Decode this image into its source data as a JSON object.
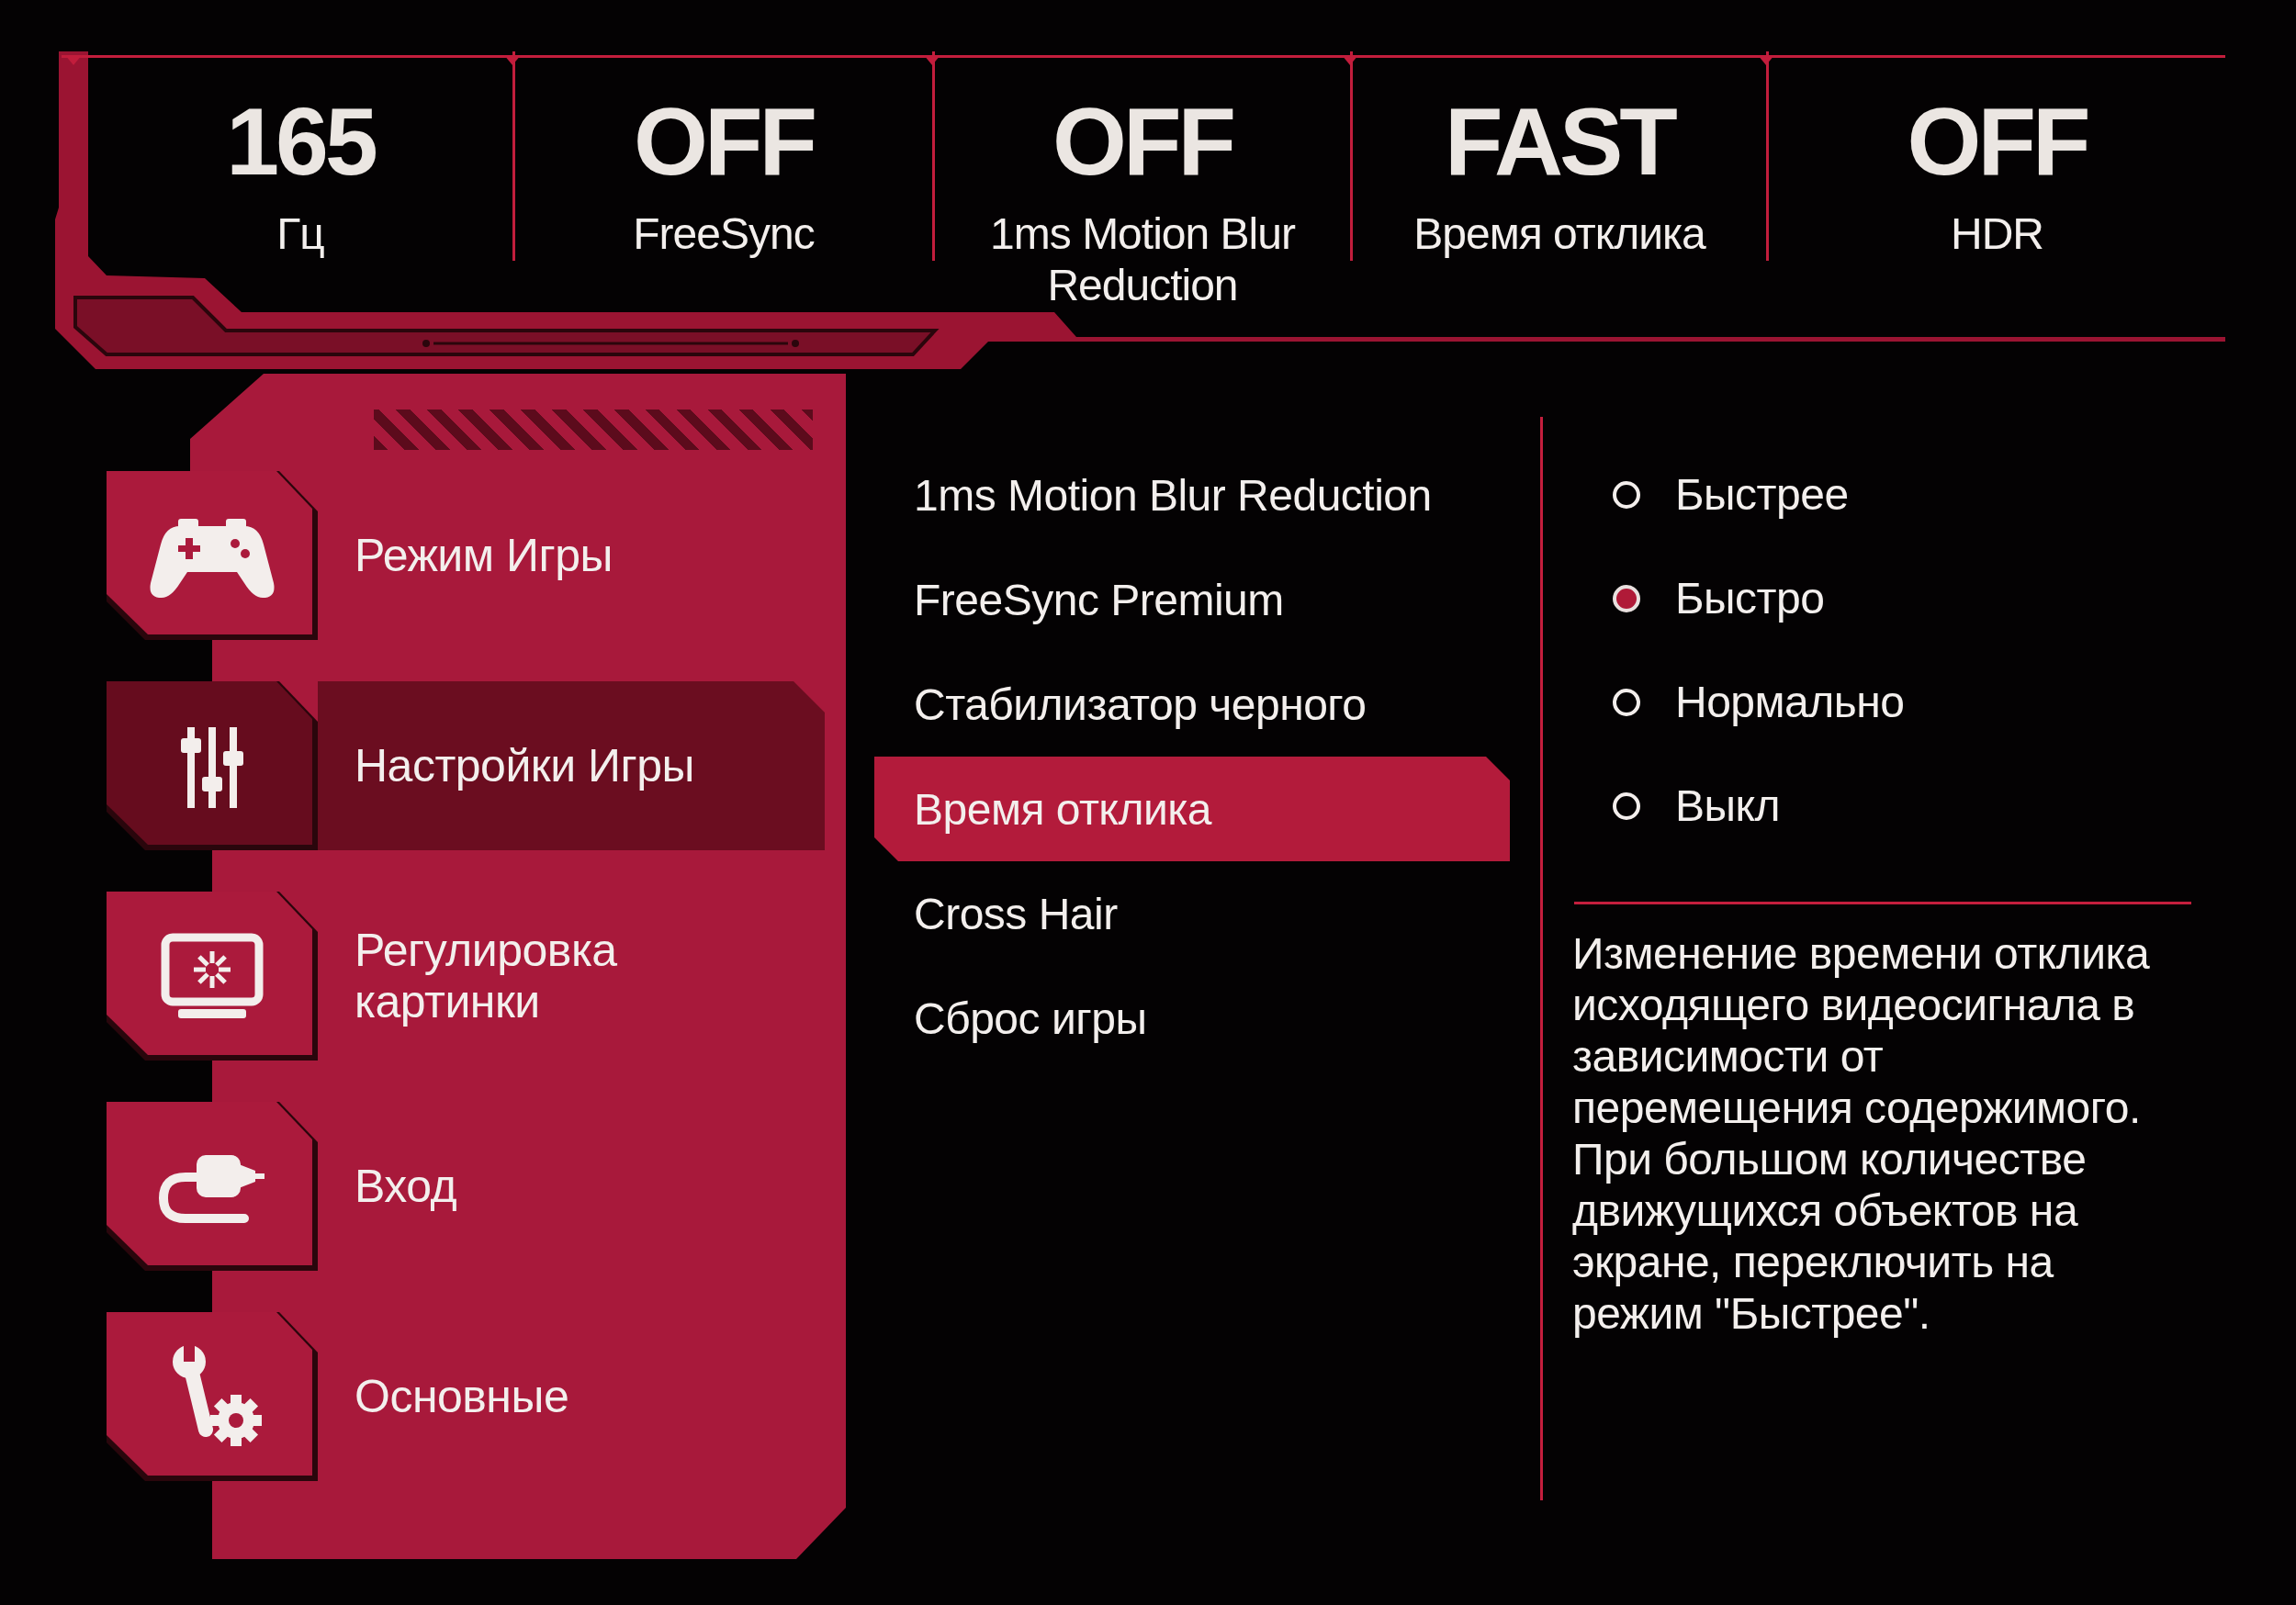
{
  "status_bar": [
    {
      "value": "165",
      "label": "Гц"
    },
    {
      "value": "OFF",
      "label": "FreeSync"
    },
    {
      "value": "OFF",
      "label": "1ms Motion Blur Reduction"
    },
    {
      "value": "FAST",
      "label": "Время отклика"
    },
    {
      "value": "OFF",
      "label": "HDR"
    }
  ],
  "sidebar": {
    "items": [
      {
        "label": "Режим Игры",
        "selected": false
      },
      {
        "label": "Настройки Игры",
        "selected": true
      },
      {
        "label": "Регулировка картинки",
        "selected": false
      },
      {
        "label": "Вход",
        "selected": false
      },
      {
        "label": "Основные",
        "selected": false
      }
    ]
  },
  "submenu": {
    "items": [
      {
        "label": "1ms Motion Blur Reduction",
        "selected": false
      },
      {
        "label": "FreeSync Premium",
        "selected": false
      },
      {
        "label": "Стабилизатор черного",
        "selected": false
      },
      {
        "label": "Время отклика",
        "selected": true
      },
      {
        "label": "Cross Hair",
        "selected": false
      },
      {
        "label": "Сброс игры",
        "selected": false
      }
    ]
  },
  "options": {
    "items": [
      {
        "label": "Быстрее",
        "selected": false
      },
      {
        "label": "Быстро",
        "selected": true
      },
      {
        "label": "Нормально",
        "selected": false
      },
      {
        "label": "Выкл",
        "selected": false
      }
    ]
  },
  "description": "Изменение времени отклика исходящего видеосигнала в зависимости от перемещения содержимого. При большом количестве движущихся объектов на экране, переключить на режим \"Быстрее\"."
}
